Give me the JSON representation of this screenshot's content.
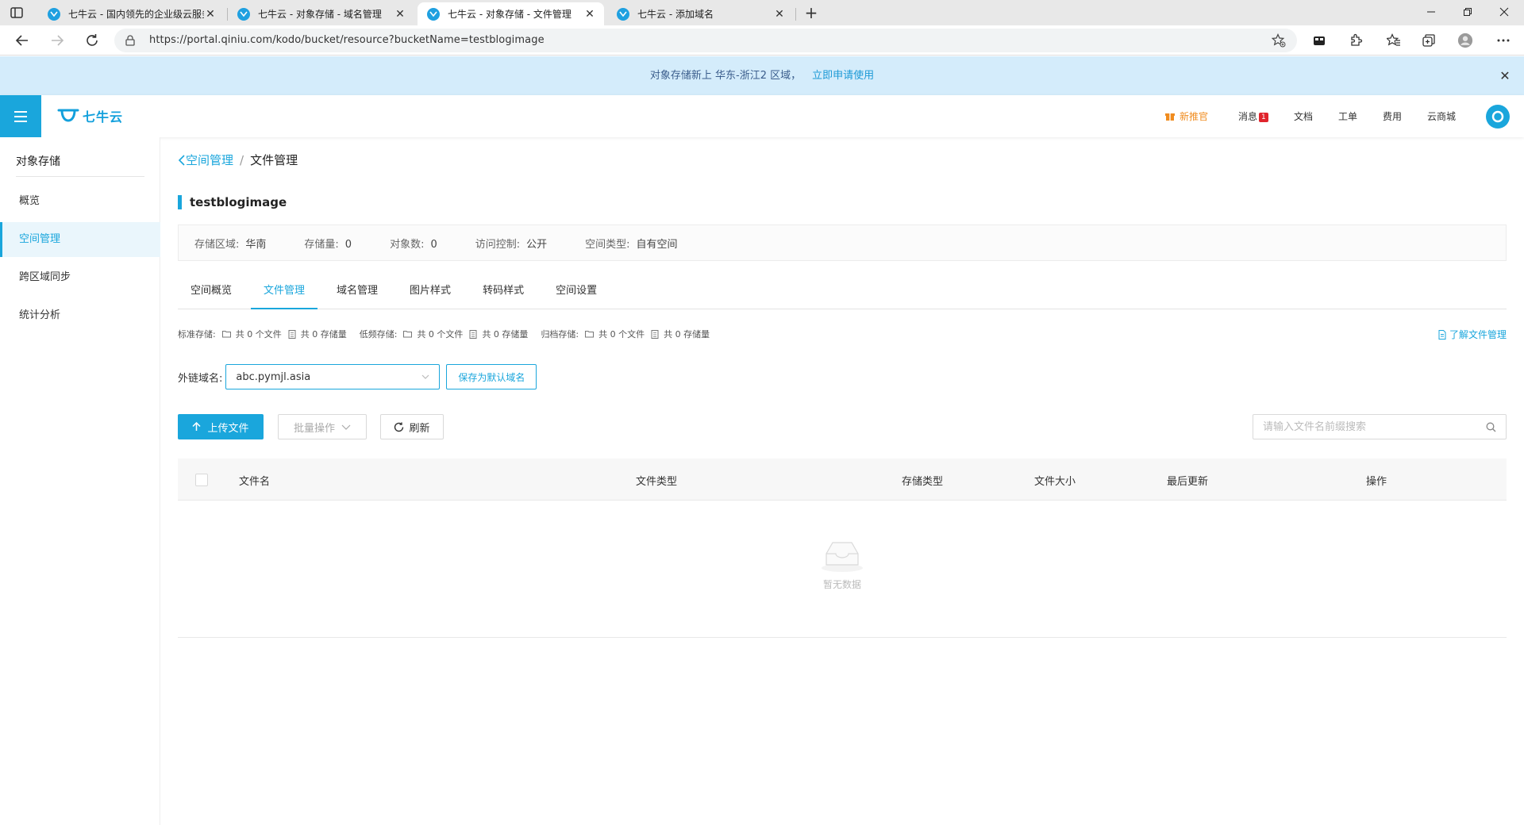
{
  "browser": {
    "tabs": [
      {
        "title": "七牛云 - 国内领先的企业级云服务商",
        "active": false
      },
      {
        "title": "七牛云 - 对象存储 - 域名管理",
        "active": false
      },
      {
        "title": "七牛云 - 对象存储 - 文件管理",
        "active": true
      },
      {
        "title": "七牛云 - 添加域名",
        "active": false
      }
    ],
    "url": "https://portal.qiniu.com/kodo/bucket/resource?bucketName=testblogimage"
  },
  "announcement": {
    "text": "对象存储新上 华东-浙江2 区域，",
    "link": "立即申请使用"
  },
  "header": {
    "logo_text": "七牛云",
    "promo": "新推官",
    "messages": "消息",
    "message_count": "1",
    "docs": "文档",
    "tickets": "工单",
    "billing": "费用",
    "market": "云商城"
  },
  "sidebar": {
    "section": "对象存储",
    "items": [
      {
        "label": "概览"
      },
      {
        "label": "空间管理",
        "active": true
      },
      {
        "label": "跨区域同步"
      },
      {
        "label": "统计分析"
      }
    ]
  },
  "main": {
    "breadcrumb": {
      "parent": "空间管理",
      "sep": "/",
      "current": "文件管理"
    },
    "bucket_name": "testblogimage",
    "info": {
      "region_label": "存储区域:",
      "region": "华南",
      "storage_label": "存储量:",
      "storage": "0",
      "objects_label": "对象数:",
      "objects": "0",
      "access_label": "访问控制:",
      "access": "公开",
      "type_label": "空间类型:",
      "type": "自有空间"
    },
    "tabs": [
      {
        "label": "空间概览"
      },
      {
        "label": "文件管理",
        "active": true
      },
      {
        "label": "域名管理"
      },
      {
        "label": "图片样式"
      },
      {
        "label": "转码样式"
      },
      {
        "label": "空间设置"
      }
    ],
    "storage_summary": [
      {
        "label": "标准存储:",
        "files": "共 0 个文件",
        "size": "共 0 存储量"
      },
      {
        "label": "低频存储:",
        "files": "共 0 个文件",
        "size": "共 0 存储量"
      },
      {
        "label": "归档存储:",
        "files": "共 0 个文件",
        "size": "共 0 存储量"
      }
    ],
    "learn_link": "了解文件管理",
    "domain_label": "外链域名:",
    "domain_value": "abc.pymjl.asia",
    "save_default": "保存为默认域名",
    "upload": "上传文件",
    "batch": "批量操作",
    "refresh": "刷新",
    "search_placeholder": "请输入文件名前缀搜索",
    "columns": [
      "文件名",
      "文件类型",
      "存储类型",
      "文件大小",
      "最后更新",
      "操作"
    ],
    "empty": "暂无数据"
  }
}
